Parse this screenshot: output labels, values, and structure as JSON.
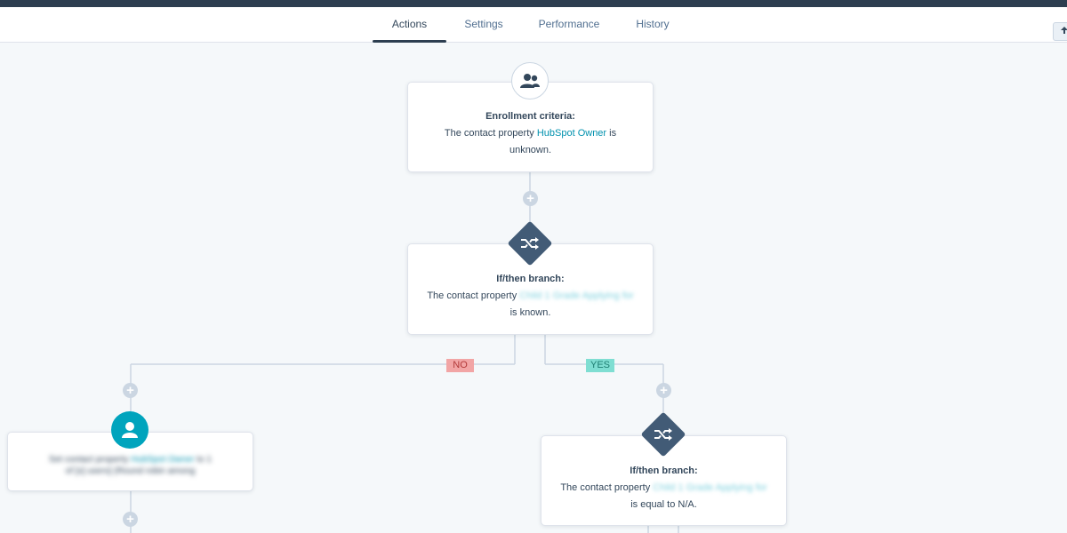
{
  "tabs": [
    {
      "label": "Actions",
      "active": true
    },
    {
      "label": "Settings",
      "active": false
    },
    {
      "label": "Performance",
      "active": false
    },
    {
      "label": "History",
      "active": false
    }
  ],
  "enrollment": {
    "title": "Enrollment criteria:",
    "text_before": "The contact property",
    "property": "HubSpot Owner",
    "text_is": "is",
    "text_after": "unknown."
  },
  "branch1": {
    "title": "If/then branch:",
    "text_before": "The contact property",
    "property_redacted": "Child 1 Grade Applying for",
    "text_after": "is known."
  },
  "branch_labels": {
    "no": "NO",
    "yes": "YES"
  },
  "action_left": {
    "line1_dark": "Set contact property",
    "line1_link": "HubSpot Owner",
    "line1_end": "to 1",
    "line2": "of [x] users] (Round robin among"
  },
  "branch2": {
    "title": "If/then branch:",
    "text_before": "The contact property",
    "property_redacted": "Child 1 Grade Applying for",
    "text_after": "is equal to N/A."
  },
  "icons": {
    "enrollment": "contacts-icon",
    "branch": "shuffle-icon",
    "action": "person-icon",
    "add": "plus-icon"
  },
  "colors": {
    "nav_dark": "#2d3e50",
    "diamond": "#425b76",
    "teal": "#00a4bd",
    "link": "#0091ae",
    "no_tag": "#f2a5a5",
    "yes_tag": "#7fded2"
  }
}
